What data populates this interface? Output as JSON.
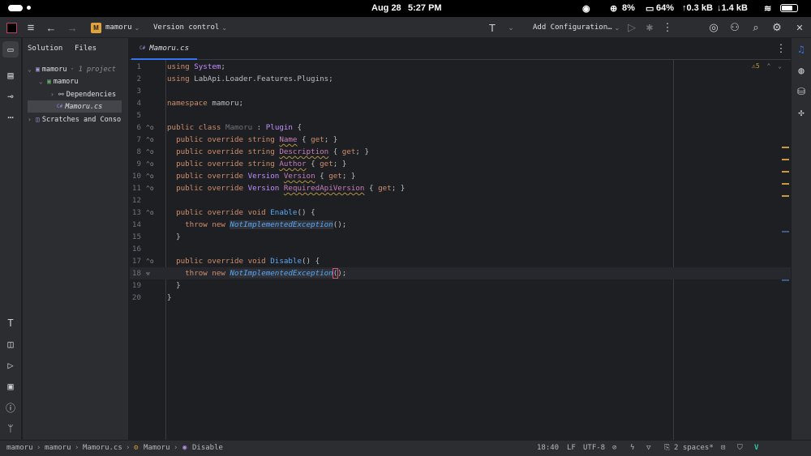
{
  "status_bar": {
    "date": "Aug 28",
    "time": "5:27 PM",
    "cpu": "8%",
    "battery": "64%",
    "upload": "↑0.3 kB",
    "download": "↓1.4 kB"
  },
  "titlebar": {
    "project_badge": "M",
    "project_name": "mamoru",
    "vcs": "Version control",
    "run_config": "Add Configuration…"
  },
  "project_panel": {
    "tab_solution": "Solution",
    "tab_files": "Files",
    "tree": [
      {
        "label": "mamoru",
        "suffix": "· 1 project",
        "arrow": "⌄",
        "icon": "sln"
      },
      {
        "label": "mamoru",
        "suffix": "",
        "arrow": "⌄",
        "icon": "C#"
      },
      {
        "label": "Dependencies",
        "suffix": "",
        "arrow": "›",
        "icon": "dep"
      },
      {
        "label": "Mamoru.cs",
        "suffix": "",
        "arrow": "",
        "icon": "C#"
      },
      {
        "label": "Scratches and Conso",
        "suffix": "",
        "arrow": "›",
        "icon": "scr"
      }
    ]
  },
  "editor": {
    "tab_label": "Mamoru.cs",
    "tab_icon": "C#",
    "warnings_count": "5",
    "lines": [
      {
        "n": "1"
      },
      {
        "n": "2"
      },
      {
        "n": "3"
      },
      {
        "n": "4"
      },
      {
        "n": "5"
      },
      {
        "n": "6"
      },
      {
        "n": "7"
      },
      {
        "n": "8"
      },
      {
        "n": "9"
      },
      {
        "n": "10"
      },
      {
        "n": "11"
      },
      {
        "n": "12"
      },
      {
        "n": "13"
      },
      {
        "n": "14"
      },
      {
        "n": "15"
      },
      {
        "n": "16"
      },
      {
        "n": "17"
      },
      {
        "n": "18"
      },
      {
        "n": "19"
      },
      {
        "n": "20"
      }
    ]
  },
  "bottombar": {
    "breadcrumb": [
      "mamoru",
      "mamoru",
      "Mamoru.cs",
      "Mamoru",
      "Disable"
    ],
    "position": "18:40",
    "line_sep": "LF",
    "encoding": "UTF-8",
    "indent": "2 spaces*"
  },
  "colors": {
    "accent": "#3574f0",
    "project_badge": "#e0a33a"
  }
}
